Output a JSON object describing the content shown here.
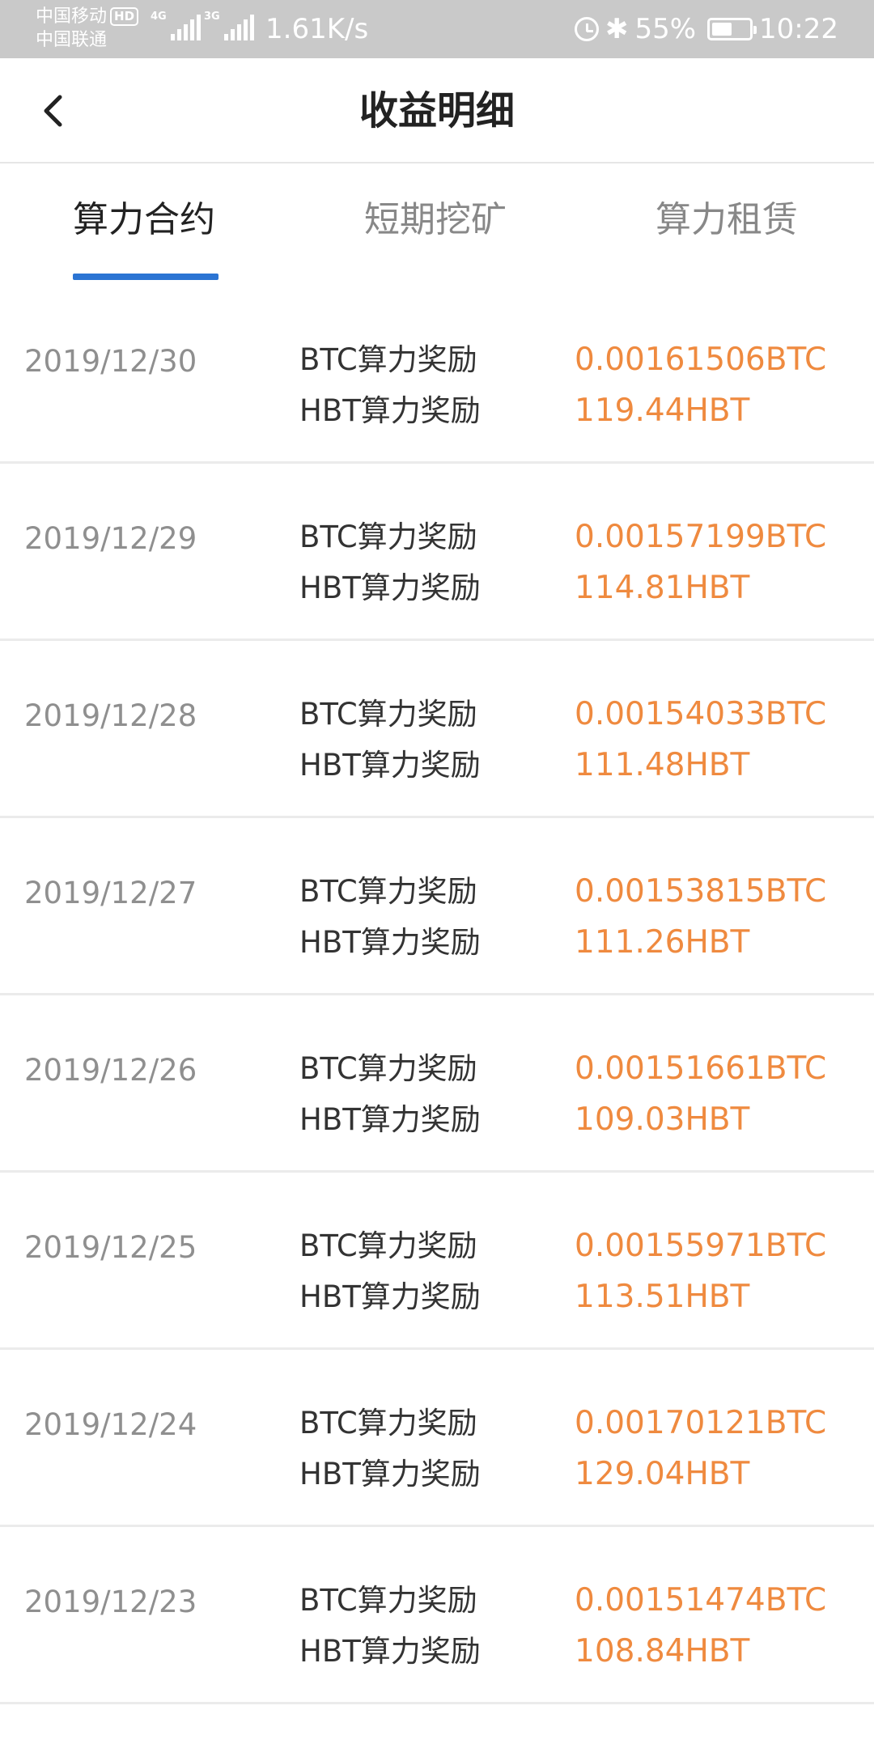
{
  "status_bar": {
    "carrier_1": "中国移动",
    "hd_badge": "HD",
    "carrier_2": "中国联通",
    "network_1": "4G",
    "network_2": "3G",
    "speed": "1.61K/s",
    "battery_percent": "55%",
    "battery_level": 0.55,
    "time": "10:22"
  },
  "header": {
    "title": "收益明细"
  },
  "tabs": [
    {
      "label": "算力合约",
      "active": true
    },
    {
      "label": "短期挖矿",
      "active": false
    },
    {
      "label": "算力租赁",
      "active": false
    }
  ],
  "rewards": [
    {
      "date": "2019/12/30",
      "btc_label": "BTC算力奖励",
      "btc_value": "0.00161506BTC",
      "hbt_label": "HBT算力奖励",
      "hbt_value": "119.44HBT"
    },
    {
      "date": "2019/12/29",
      "btc_label": "BTC算力奖励",
      "btc_value": "0.00157199BTC",
      "hbt_label": "HBT算力奖励",
      "hbt_value": "114.81HBT"
    },
    {
      "date": "2019/12/28",
      "btc_label": "BTC算力奖励",
      "btc_value": "0.00154033BTC",
      "hbt_label": "HBT算力奖励",
      "hbt_value": "111.48HBT"
    },
    {
      "date": "2019/12/27",
      "btc_label": "BTC算力奖励",
      "btc_value": "0.00153815BTC",
      "hbt_label": "HBT算力奖励",
      "hbt_value": "111.26HBT"
    },
    {
      "date": "2019/12/26",
      "btc_label": "BTC算力奖励",
      "btc_value": "0.00151661BTC",
      "hbt_label": "HBT算力奖励",
      "hbt_value": "109.03HBT"
    },
    {
      "date": "2019/12/25",
      "btc_label": "BTC算力奖励",
      "btc_value": "0.00155971BTC",
      "hbt_label": "HBT算力奖励",
      "hbt_value": "113.51HBT"
    },
    {
      "date": "2019/12/24",
      "btc_label": "BTC算力奖励",
      "btc_value": "0.00170121BTC",
      "hbt_label": "HBT算力奖励",
      "hbt_value": "129.04HBT"
    },
    {
      "date": "2019/12/23",
      "btc_label": "BTC算力奖励",
      "btc_value": "0.00151474BTC",
      "hbt_label": "HBT算力奖励",
      "hbt_value": "108.84HBT"
    }
  ],
  "colors": {
    "accent": "#2b74d3",
    "value": "#ef8a3f",
    "status_bar": "#c9c9c9"
  }
}
